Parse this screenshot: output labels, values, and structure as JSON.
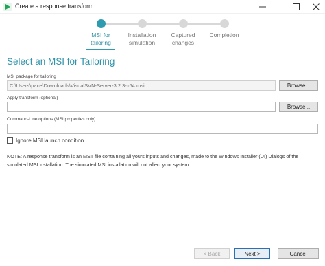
{
  "window": {
    "title": "Create a response transform",
    "accent_color": "#2f9bb1",
    "app_icon": "play-triangle-icon"
  },
  "stepper": {
    "steps": [
      {
        "label": "MSI for tailoring",
        "active": true
      },
      {
        "label": "Installation simulation",
        "active": false
      },
      {
        "label": "Captured changes",
        "active": false
      },
      {
        "label": "Completion",
        "active": false
      }
    ]
  },
  "heading": "Select an MSI for Tailoring",
  "fields": {
    "msi_package": {
      "label": "MSI package for tailoring",
      "value": "C:\\Users\\pace\\Downloads\\VisualSVN-Server-3.2.3-x64.msi",
      "browse_label": "Browse..."
    },
    "apply_transform": {
      "label": "Apply transform (optional)",
      "value": "",
      "browse_label": "Browse..."
    },
    "command_line": {
      "label": "Command-Line options (MSI properties only)",
      "value": ""
    }
  },
  "ignore_checkbox": {
    "label": "Ignore MSI launch condition",
    "checked": false
  },
  "note": "NOTE:  A response transform is an MST file containing all yours inputs and changes, made to the Windows Installer (UI) Dialogs of the simulated MSI installation. The simulated MSI installation will not affect your system.",
  "footer": {
    "back_label": "< Back",
    "next_label": "Next >",
    "cancel_label": "Cancel"
  }
}
